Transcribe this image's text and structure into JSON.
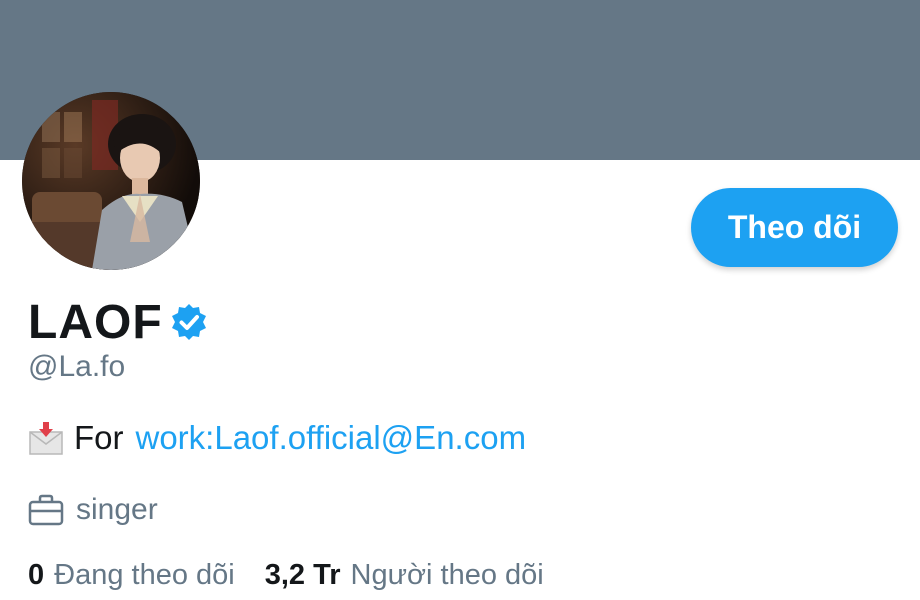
{
  "profile": {
    "display_name": "LAOF",
    "handle": "@La.fo",
    "verified_icon": "verified-badge-icon",
    "follow_button_label": "Theo dõi",
    "bio": {
      "icon": "envelope-with-arrow-icon",
      "prefix": "For",
      "link_text": "work:Laof.official@En.com"
    },
    "job": {
      "icon": "briefcase-icon",
      "text": "singer"
    },
    "stats": {
      "following_count": "0",
      "following_label": "Đang theo dõi",
      "followers_count": "3,2 Tr",
      "followers_label": "Người theo dõi"
    }
  },
  "colors": {
    "banner": "#657786",
    "accent": "#1da1f2",
    "text_primary": "#14171a",
    "text_secondary": "#657786"
  }
}
